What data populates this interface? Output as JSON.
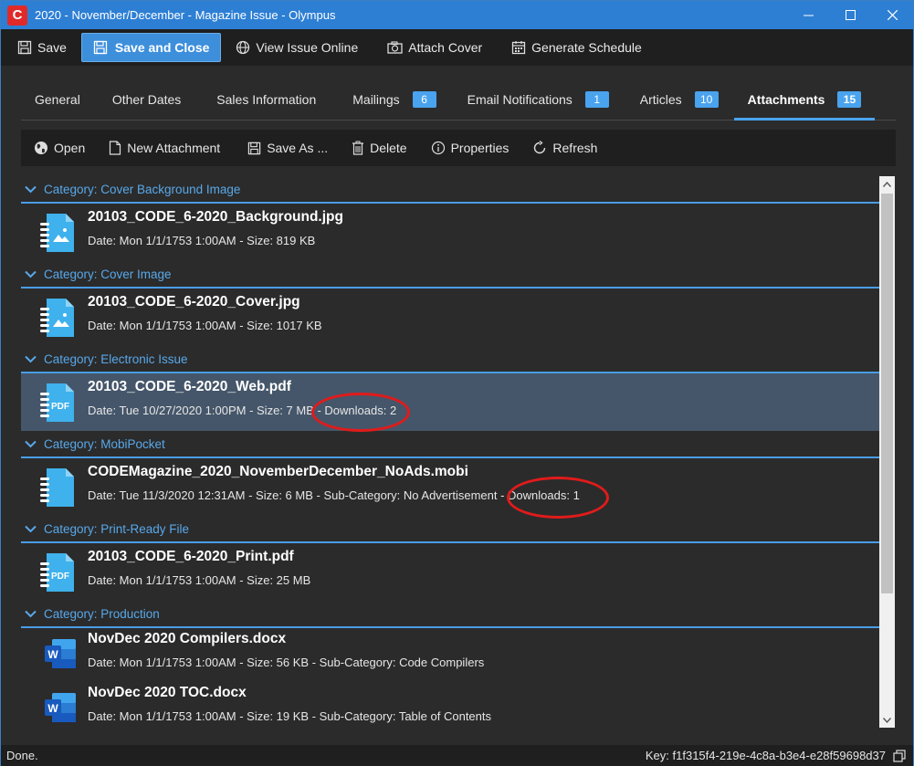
{
  "window": {
    "title": "2020 - November/December - Magazine Issue - Olympus",
    "app_logo": "C"
  },
  "toolbar": {
    "save": "Save",
    "save_close": "Save and Close",
    "view_online": "View Issue Online",
    "attach_cover": "Attach Cover",
    "generate_schedule": "Generate Schedule"
  },
  "tabs": [
    {
      "label": "General",
      "badge": ""
    },
    {
      "label": "Other Dates",
      "badge": ""
    },
    {
      "label": "Sales Information",
      "badge": ""
    },
    {
      "label": "Mailings",
      "badge": "6"
    },
    {
      "label": "Email Notifications",
      "badge": "1"
    },
    {
      "label": "Articles",
      "badge": "10"
    },
    {
      "label": "Attachments",
      "badge": "15"
    }
  ],
  "subtoolbar": {
    "open": "Open",
    "new_attachment": "New Attachment",
    "save_as": "Save As ...",
    "delete": "Delete",
    "properties": "Properties",
    "refresh": "Refresh"
  },
  "groups": [
    {
      "category": "Category:  Cover Background Image",
      "items": [
        {
          "name": "20103_CODE_6-2020_Background.jpg",
          "meta": "Date: Mon 1/1/1753 1:00AM - Size: 819 KB",
          "icon": "image-file-icon"
        }
      ]
    },
    {
      "category": "Category:  Cover Image",
      "items": [
        {
          "name": "20103_CODE_6-2020_Cover.jpg",
          "meta": "Date: Mon 1/1/1753 1:00AM - Size: 1017 KB",
          "icon": "image-file-icon"
        }
      ]
    },
    {
      "category": "Category:  Electronic Issue",
      "items": [
        {
          "name": "20103_CODE_6-2020_Web.pdf",
          "meta": "Date: Tue 10/27/2020 1:00PM - Size: 7 MB - Downloads: 2",
          "icon": "pdf-file-icon"
        }
      ]
    },
    {
      "category": "Category:  MobiPocket",
      "items": [
        {
          "name": "CODEMagazine_2020_NovemberDecember_NoAds.mobi",
          "meta": "Date: Tue 11/3/2020 12:31AM - Size: 6 MB - Sub-Category: No Advertisement - Downloads: 1",
          "icon": "file-icon"
        }
      ]
    },
    {
      "category": "Category:  Print-Ready File",
      "items": [
        {
          "name": "20103_CODE_6-2020_Print.pdf",
          "meta": "Date: Mon 1/1/1753 1:00AM - Size: 25 MB",
          "icon": "pdf-file-icon"
        }
      ]
    },
    {
      "category": "Category:  Production",
      "items": [
        {
          "name": "NovDec 2020 Compilers.docx",
          "meta": "Date: Mon 1/1/1753 1:00AM - Size: 56 KB - Sub-Category: Code Compilers",
          "icon": "word-file-icon"
        },
        {
          "name": "NovDec 2020 TOC.docx",
          "meta": "Date: Mon 1/1/1753 1:00AM - Size: 19 KB - Sub-Category: Table of Contents",
          "icon": "word-file-icon"
        }
      ]
    }
  ],
  "status": {
    "left": "Done.",
    "key": "Key: f1f315f4-219e-4c8a-b3e4-e28f59698d37"
  },
  "colors": {
    "accent": "#4aa3ee",
    "titlebar": "#2d7fd4",
    "selected_row": "#45566a",
    "annotation": "#e01b1b"
  }
}
